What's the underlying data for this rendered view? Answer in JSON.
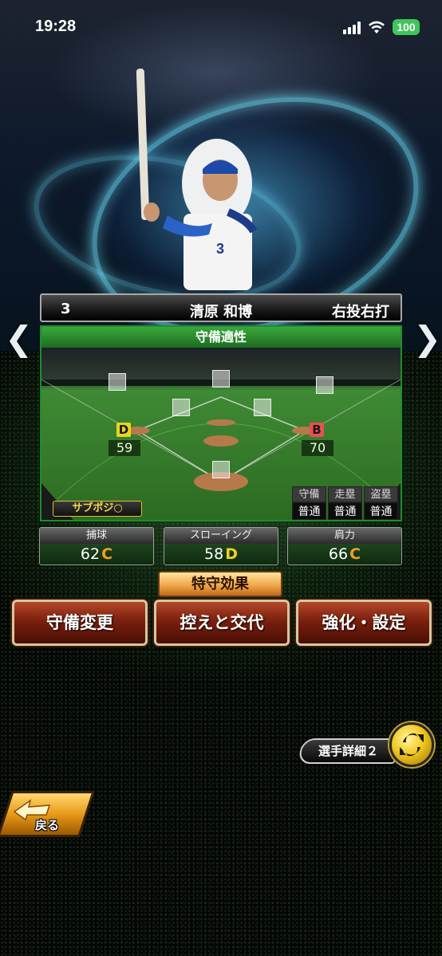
{
  "status_bar": {
    "time": "19:28",
    "battery": "100"
  },
  "player": {
    "number": "3",
    "name": "清原 和博",
    "batting": "右投右打",
    "uniform_number": "3"
  },
  "defense": {
    "title": "守備適性",
    "positions": [
      {
        "grade": "D",
        "value": "59",
        "grade_color": "#e8d420"
      },
      {
        "grade": "B",
        "value": "70",
        "grade_color": "#e85050"
      }
    ],
    "sub_position": "サブポジ○",
    "abilities": {
      "headers": [
        "守備",
        "走塁",
        "盗塁"
      ],
      "values": [
        "普通",
        "普通",
        "普通"
      ]
    }
  },
  "stats": [
    {
      "label": "捕球",
      "value": "62",
      "grade": "C",
      "grade_color": "#f0a020"
    },
    {
      "label": "スローイング",
      "value": "58",
      "grade": "D",
      "grade_color": "#f0d020"
    },
    {
      "label": "肩力",
      "value": "66",
      "grade": "C",
      "grade_color": "#f0a020"
    }
  ],
  "buttons": {
    "special_defense": "特守効果",
    "change_defense": "守備変更",
    "substitute": "控えと交代",
    "enhance_settings": "強化・設定",
    "player_detail": "選手詳細２",
    "back": "戻る"
  }
}
